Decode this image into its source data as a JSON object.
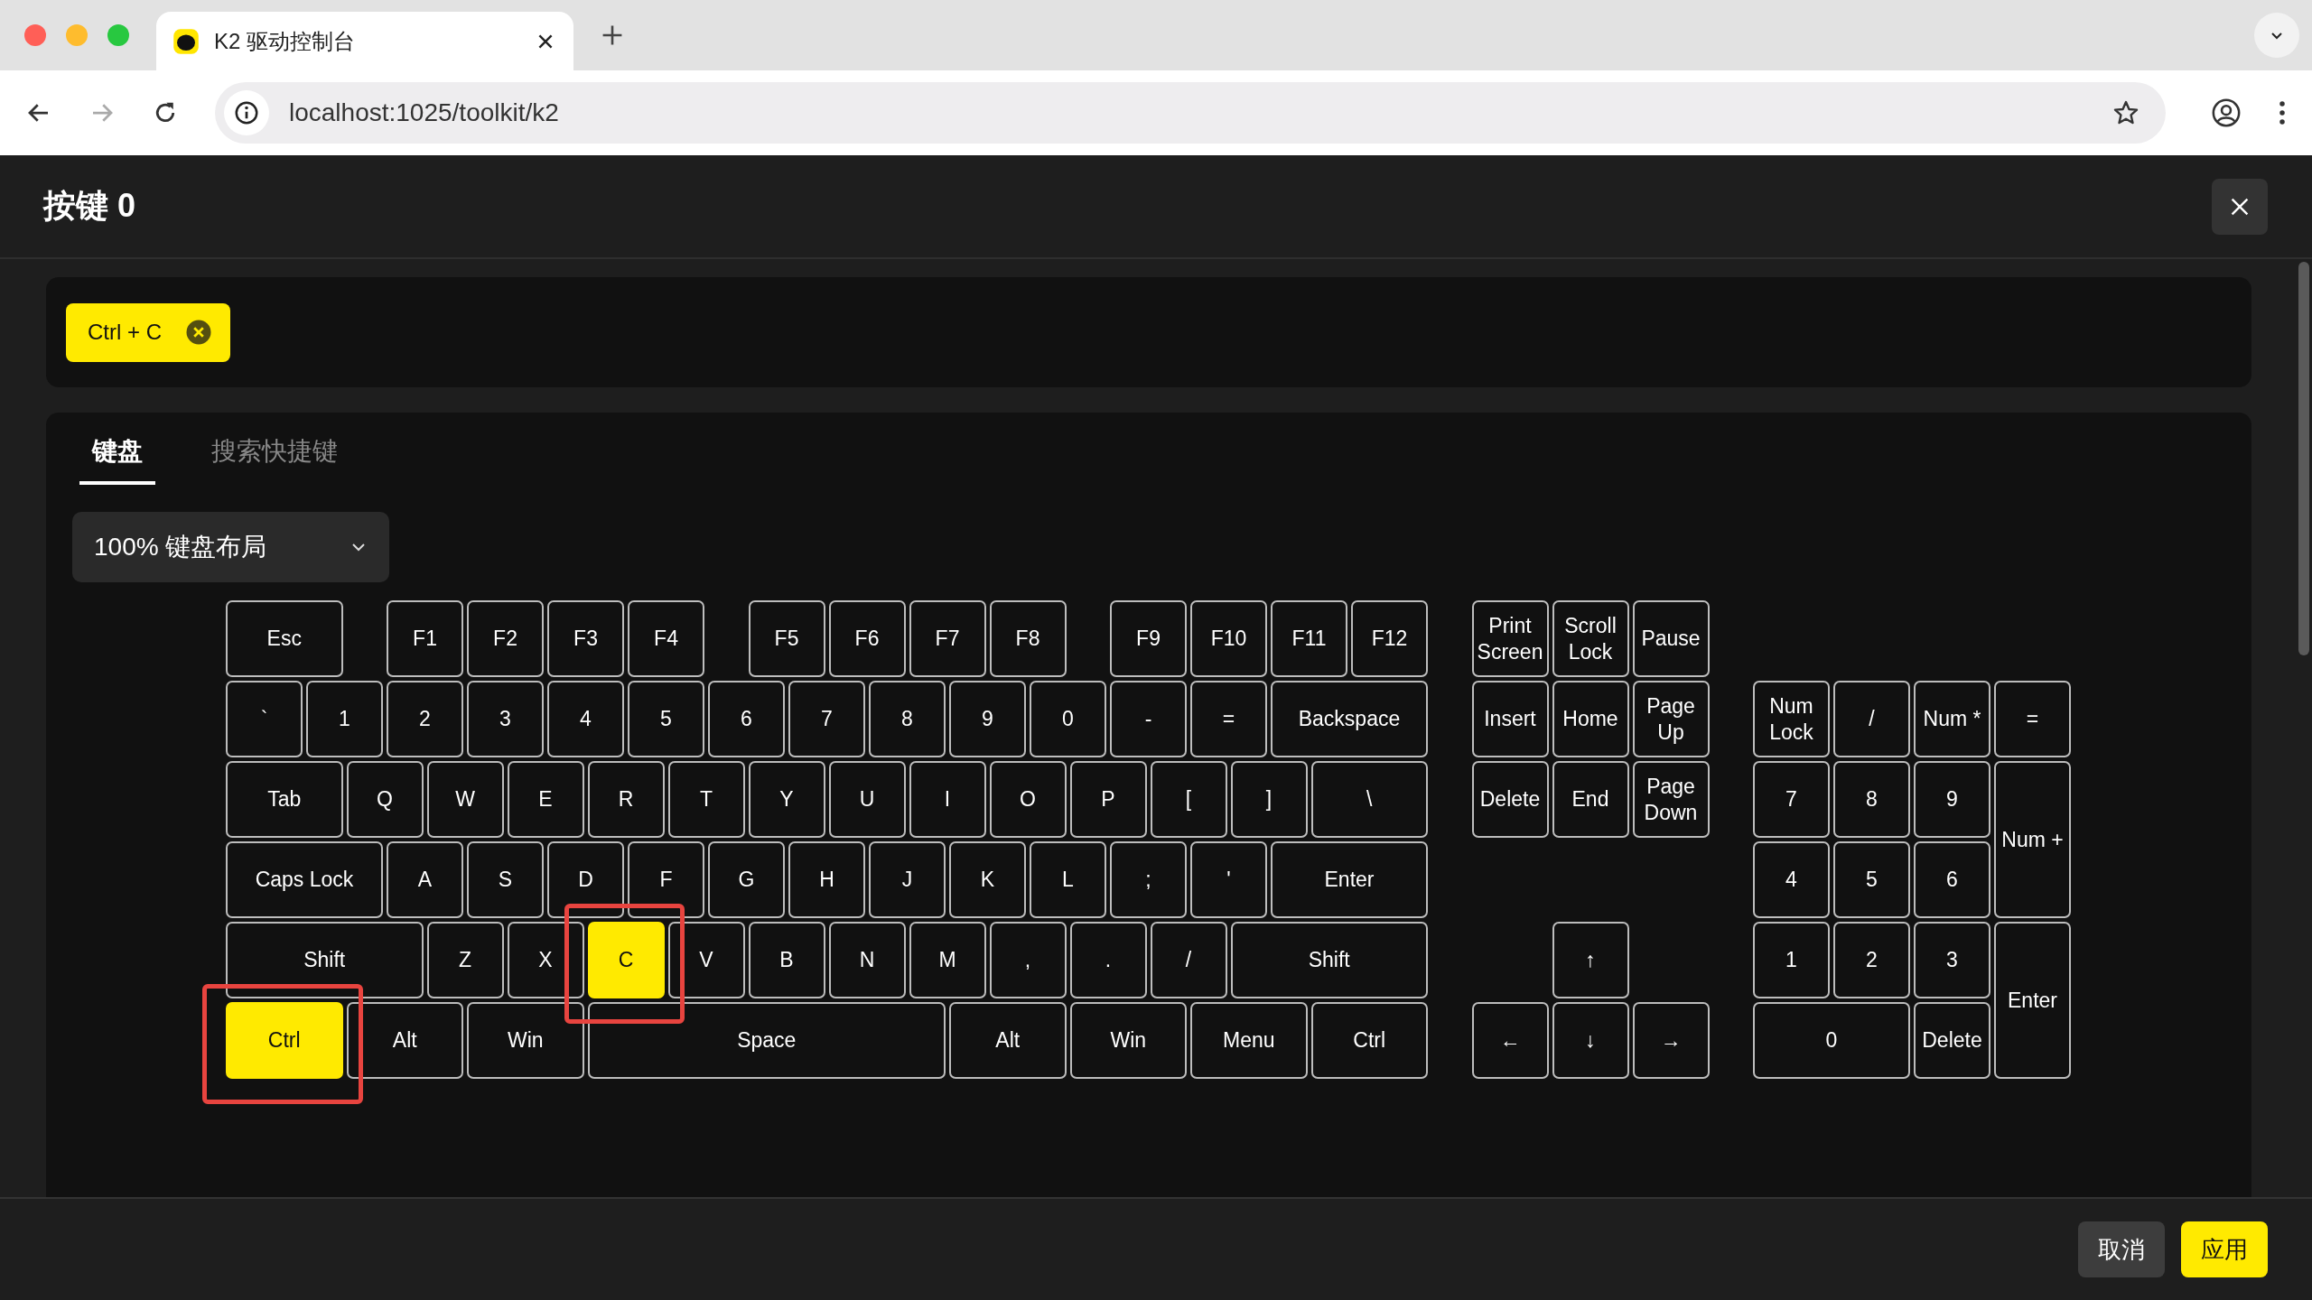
{
  "browser": {
    "tab_title": "K2 驱动控制台",
    "url": "localhost:1025/toolkit/k2"
  },
  "dialog": {
    "title": "按键 0",
    "shortcuts": [
      {
        "label": "Ctrl + C"
      }
    ],
    "tabs": [
      {
        "label": "键盘",
        "selected": true
      },
      {
        "label": "搜索快捷键",
        "selected": false
      }
    ],
    "layout_select": {
      "value": "100% 键盘布局"
    },
    "keyboard": {
      "main_rows": [
        [
          {
            "label": "Esc",
            "selected": false
          },
          {
            "label": "F1",
            "selected": false
          },
          {
            "label": "F2",
            "selected": false
          },
          {
            "label": "F3",
            "selected": false
          },
          {
            "label": "F4",
            "selected": false
          },
          {
            "label": "F5",
            "selected": false
          },
          {
            "label": "F6",
            "selected": false
          },
          {
            "label": "F7",
            "selected": false
          },
          {
            "label": "F8",
            "selected": false
          },
          {
            "label": "F9",
            "selected": false
          },
          {
            "label": "F10",
            "selected": false
          },
          {
            "label": "F11",
            "selected": false
          },
          {
            "label": "F12",
            "selected": false
          }
        ],
        [
          {
            "label": "`",
            "selected": false
          },
          {
            "label": "1",
            "selected": false
          },
          {
            "label": "2",
            "selected": false
          },
          {
            "label": "3",
            "selected": false
          },
          {
            "label": "4",
            "selected": false
          },
          {
            "label": "5",
            "selected": false
          },
          {
            "label": "6",
            "selected": false
          },
          {
            "label": "7",
            "selected": false
          },
          {
            "label": "8",
            "selected": false
          },
          {
            "label": "9",
            "selected": false
          },
          {
            "label": "0",
            "selected": false
          },
          {
            "label": "-",
            "selected": false
          },
          {
            "label": "=",
            "selected": false
          },
          {
            "label": "Backspace",
            "selected": false
          }
        ],
        [
          {
            "label": "Tab",
            "selected": false
          },
          {
            "label": "Q",
            "selected": false
          },
          {
            "label": "W",
            "selected": false
          },
          {
            "label": "E",
            "selected": false
          },
          {
            "label": "R",
            "selected": false
          },
          {
            "label": "T",
            "selected": false
          },
          {
            "label": "Y",
            "selected": false
          },
          {
            "label": "U",
            "selected": false
          },
          {
            "label": "I",
            "selected": false
          },
          {
            "label": "O",
            "selected": false
          },
          {
            "label": "P",
            "selected": false
          },
          {
            "label": "[",
            "selected": false
          },
          {
            "label": "]",
            "selected": false
          },
          {
            "label": "\\",
            "selected": false
          }
        ],
        [
          {
            "label": "Caps Lock",
            "selected": false
          },
          {
            "label": "A",
            "selected": false
          },
          {
            "label": "S",
            "selected": false
          },
          {
            "label": "D",
            "selected": false
          },
          {
            "label": "F",
            "selected": false
          },
          {
            "label": "G",
            "selected": false
          },
          {
            "label": "H",
            "selected": false
          },
          {
            "label": "J",
            "selected": false
          },
          {
            "label": "K",
            "selected": false
          },
          {
            "label": "L",
            "selected": false
          },
          {
            "label": ";",
            "selected": false
          },
          {
            "label": "'",
            "selected": false
          },
          {
            "label": "Enter",
            "selected": false
          }
        ],
        [
          {
            "label": "Shift",
            "selected": false
          },
          {
            "label": "Z",
            "selected": false
          },
          {
            "label": "X",
            "selected": false
          },
          {
            "label": "C",
            "selected": true
          },
          {
            "label": "V",
            "selected": false
          },
          {
            "label": "B",
            "selected": false
          },
          {
            "label": "N",
            "selected": false
          },
          {
            "label": "M",
            "selected": false
          },
          {
            "label": ",",
            "selected": false
          },
          {
            "label": ".",
            "selected": false
          },
          {
            "label": "/",
            "selected": false
          },
          {
            "label": "Shift",
            "selected": false
          }
        ],
        [
          {
            "label": "Ctrl",
            "selected": true
          },
          {
            "label": "Alt",
            "selected": false
          },
          {
            "label": "Win",
            "selected": false
          },
          {
            "label": "Space",
            "selected": false
          },
          {
            "label": "Alt",
            "selected": false
          },
          {
            "label": "Win",
            "selected": false
          },
          {
            "label": "Menu",
            "selected": false
          },
          {
            "label": "Ctrl",
            "selected": false
          }
        ]
      ],
      "nav_rows": [
        [
          {
            "label": "Print Screen",
            "selected": false
          },
          {
            "label": "Scroll Lock",
            "selected": false
          },
          {
            "label": "Pause",
            "selected": false
          }
        ],
        [
          {
            "label": "Insert",
            "selected": false
          },
          {
            "label": "Home",
            "selected": false
          },
          {
            "label": "Page Up",
            "selected": false
          }
        ],
        [
          {
            "label": "Delete",
            "selected": false
          },
          {
            "label": "End",
            "selected": false
          },
          {
            "label": "Page Down",
            "selected": false
          }
        ],
        [
          {
            "label": "↑",
            "selected": false
          }
        ],
        [
          {
            "label": "←",
            "selected": false
          },
          {
            "label": "↓",
            "selected": false
          },
          {
            "label": "→",
            "selected": false
          }
        ]
      ],
      "numpad_rows": [
        [
          {
            "label": "Num Lock",
            "selected": false
          },
          {
            "label": "/",
            "selected": false
          },
          {
            "label": "Num *",
            "selected": false
          },
          {
            "label": "=",
            "selected": false
          }
        ],
        [
          {
            "label": "7",
            "selected": false
          },
          {
            "label": "8",
            "selected": false
          },
          {
            "label": "9",
            "selected": false
          },
          {
            "label": "Num +",
            "selected": false
          }
        ],
        [
          {
            "label": "4",
            "selected": false
          },
          {
            "label": "5",
            "selected": false
          },
          {
            "label": "6",
            "selected": false
          }
        ],
        [
          {
            "label": "1",
            "selected": false
          },
          {
            "label": "2",
            "selected": false
          },
          {
            "label": "3",
            "selected": false
          },
          {
            "label": "Enter",
            "selected": false
          }
        ],
        [
          {
            "label": "0",
            "selected": false
          },
          {
            "label": "Delete",
            "selected": false
          }
        ]
      ]
    },
    "buttons": [
      {
        "label": "取消",
        "kind": "secondary"
      },
      {
        "label": "应用",
        "kind": "primary"
      }
    ]
  }
}
